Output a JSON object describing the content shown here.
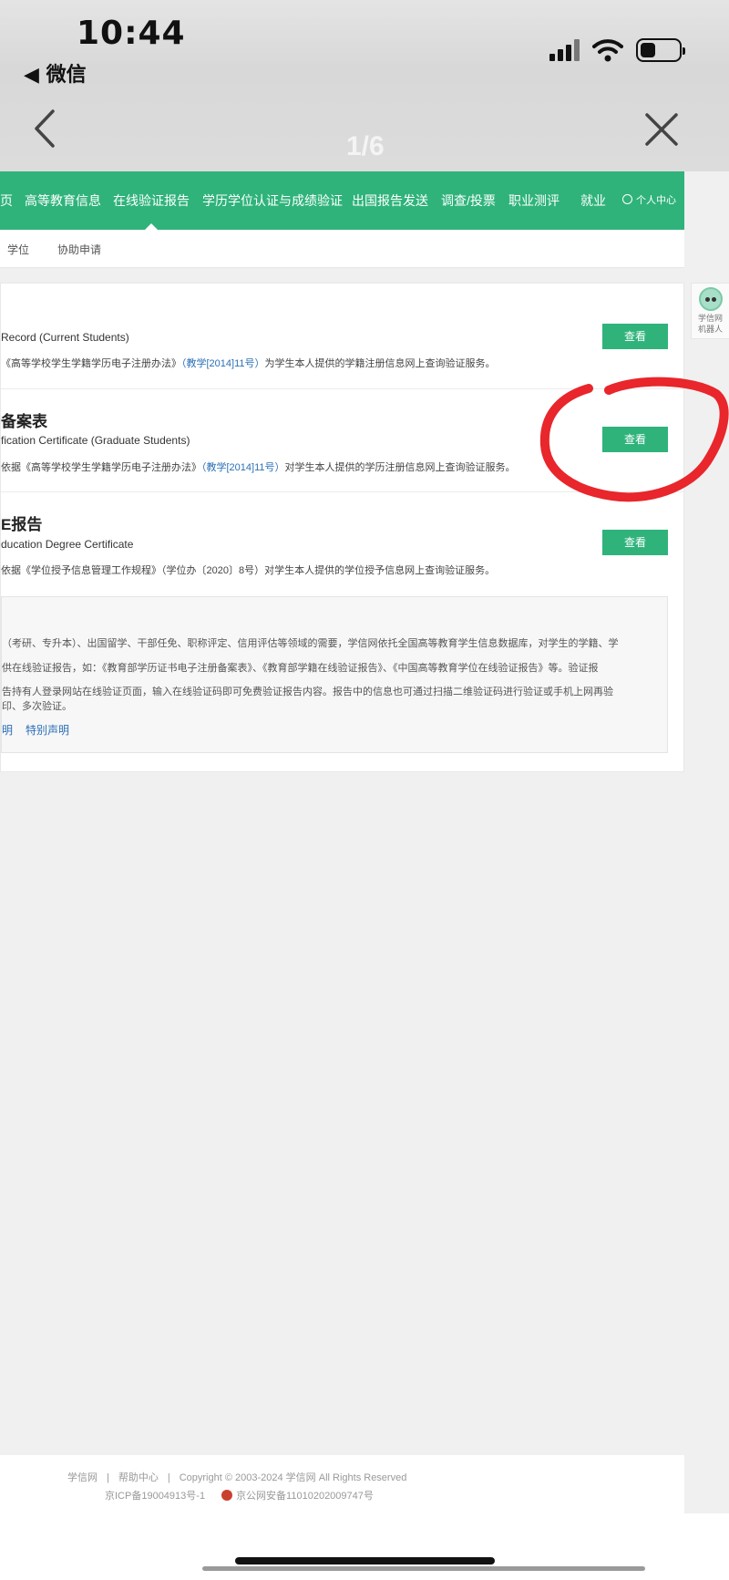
{
  "status_bar": {
    "time": "10:44",
    "back_app": "◀ 微信"
  },
  "viewer": {
    "page_indicator": "1/6"
  },
  "menu": {
    "items": [
      "页",
      "高等教育信息",
      "在线验证报告",
      "学历学位认证与成绩验证",
      "出国报告发送",
      "调查/投票",
      "职业测评",
      "就业"
    ],
    "active_index": 2,
    "user_center": "个人中心"
  },
  "subnav": {
    "items": [
      "学位",
      "协助申请"
    ]
  },
  "reports": [
    {
      "title": "",
      "subtitle": "Record (Current Students)",
      "desc_pre": "《高等学校学生学籍学历电子注册办法》",
      "desc_link": "（教学[2014]11号）",
      "desc_post": "为学生本人提供的学籍注册信息网上查询验证服务。",
      "button": "查看"
    },
    {
      "title": "备案表",
      "subtitle": "fication Certificate (Graduate Students)",
      "desc_pre": "依据《高等学校学生学籍学历电子注册办法》",
      "desc_link": "（教学[2014]11号）",
      "desc_post": "对学生本人提供的学历注册信息网上查询验证服务。",
      "button": "查看"
    },
    {
      "title": "E报告",
      "subtitle": "ducation Degree Certificate",
      "desc_pre": "依据《学位授予信息管理工作规程》（学位办〔2020〕8号）对学生本人提供的学位授予信息网上查询验证服务。",
      "desc_link": "",
      "desc_post": "",
      "button": "查看"
    }
  ],
  "notice": {
    "lines": [
      "（考研、专升本）、出国留学、干部任免、职称评定、信用评估等领域的需要，学信网依托全国高等教育学生信息数据库，对学生的学籍、学",
      "供在线验证报告，如：《教育部学历证书电子注册备案表》、《教育部学籍在线验证报告》、《中国高等教育学位在线验证报告》等。验证报",
      "告持有人登录网站在线验证页面，输入在线验证码即可免费验证报告内容。报告中的信息也可通过扫描二维验证码进行验证或手机上网再验",
      "印、多次验证。"
    ],
    "link_left": "明",
    "link_right": "特别声明"
  },
  "robot": {
    "label_line1": "学信网",
    "label_line2": "机器人"
  },
  "footer": {
    "link1": "学信网",
    "link2": "帮助中心",
    "copyright": "Copyright © 2003-2024 学信网 All Rights Reserved",
    "icp": "京ICP备19004913号-1",
    "police": "京公网安备11010202009747号"
  },
  "colors": {
    "brand_green": "#2fb37b",
    "annotation_red": "#e8262b",
    "link_blue": "#2a6fb5"
  },
  "icons": [
    "back-arrow-icon",
    "close-icon",
    "signal-icon",
    "wifi-icon",
    "battery-icon",
    "user-icon",
    "robot-icon",
    "police-badge-icon"
  ]
}
